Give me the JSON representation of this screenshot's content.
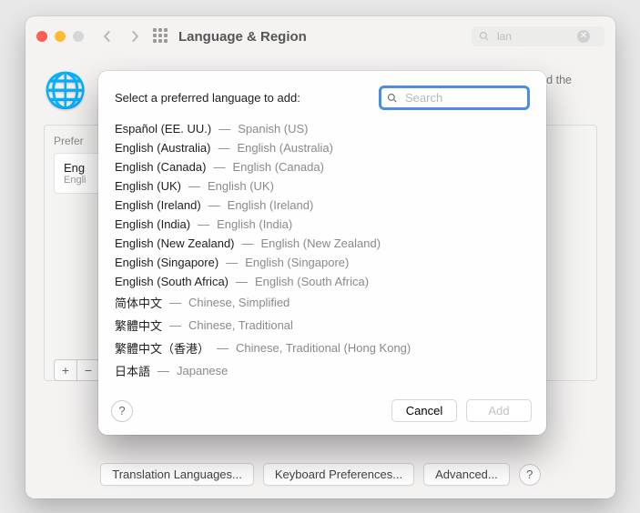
{
  "titlebar": {
    "title": "Language & Region",
    "search_value": "lan"
  },
  "hero": {
    "line_suffix": ", and the"
  },
  "sidebar": {
    "heading_visible": "Prefer",
    "selected_name_visible": "Eng",
    "selected_sub_visible": "Engli"
  },
  "bottom_buttons": {
    "translation": "Translation Languages...",
    "keyboard": "Keyboard Preferences...",
    "advanced": "Advanced..."
  },
  "modal": {
    "prompt": "Select a preferred language to add:",
    "search_placeholder": "Search",
    "cancel": "Cancel",
    "add": "Add",
    "languages": [
      {
        "native": "Español (EE. UU.)",
        "sub": "Spanish (US)"
      },
      {
        "native": "English (Australia)",
        "sub": "English (Australia)"
      },
      {
        "native": "English (Canada)",
        "sub": "English (Canada)"
      },
      {
        "native": "English (UK)",
        "sub": "English (UK)"
      },
      {
        "native": "English (Ireland)",
        "sub": "English (Ireland)"
      },
      {
        "native": "English (India)",
        "sub": "English (India)"
      },
      {
        "native": "English (New Zealand)",
        "sub": "English (New Zealand)"
      },
      {
        "native": "English (Singapore)",
        "sub": "English (Singapore)"
      },
      {
        "native": "English (South Africa)",
        "sub": "English (South Africa)"
      },
      {
        "native": "简体中文",
        "sub": "Chinese, Simplified"
      },
      {
        "native": "繁體中文",
        "sub": "Chinese, Traditional"
      },
      {
        "native": "繁體中文（香港）",
        "sub": "Chinese, Traditional (Hong Kong)"
      },
      {
        "native": "日本語",
        "sub": "Japanese"
      }
    ]
  }
}
